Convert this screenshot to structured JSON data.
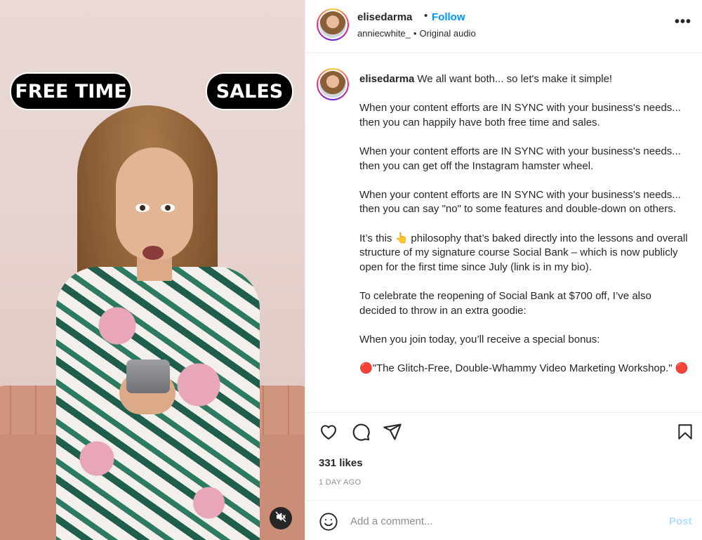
{
  "video": {
    "overlay_left": "FREE TIME",
    "overlay_right": "SALES",
    "mute_icon": "speaker-muted-icon"
  },
  "header": {
    "username": "elisedarma",
    "separator": "•",
    "follow_label": "Follow",
    "audio_user": "anniecwhite_",
    "audio_separator": "•",
    "audio_label": "Original audio",
    "more_icon_text": "•••"
  },
  "caption": {
    "username": "elisedarma",
    "paragraphs": [
      "We all want both... so let's make it simple!",
      "When your content efforts are IN SYNC with your business's needs... then you can happily have both free time and sales.",
      "When your content efforts are IN SYNC with your business's needs... then you can get off the Instagram hamster wheel.",
      "When your content efforts are IN SYNC with your business's needs... then you can say \"no\" to some features and double-down on others.",
      "It’s this 👆 philosophy that’s baked directly into the lessons and overall structure of my signature course Social Bank – which is now publicly open for the first time since July (link is in my bio).",
      "To celebrate the reopening of Social Bank at $700 off, I’ve also decided to throw in an extra goodie:",
      "When you join today, you’ll receive a special bonus:",
      "🔴\"The Glitch-Free, Double-Whammy Video Marketing Workshop.\" 🔴"
    ]
  },
  "actions": {
    "likes": "331 likes",
    "time": "1 DAY AGO"
  },
  "comment": {
    "placeholder": "Add a comment...",
    "post_label": "Post"
  },
  "colors": {
    "follow": "#0095f6",
    "post_disabled": "#b2dffc",
    "muted_text": "#8e8e8e"
  }
}
